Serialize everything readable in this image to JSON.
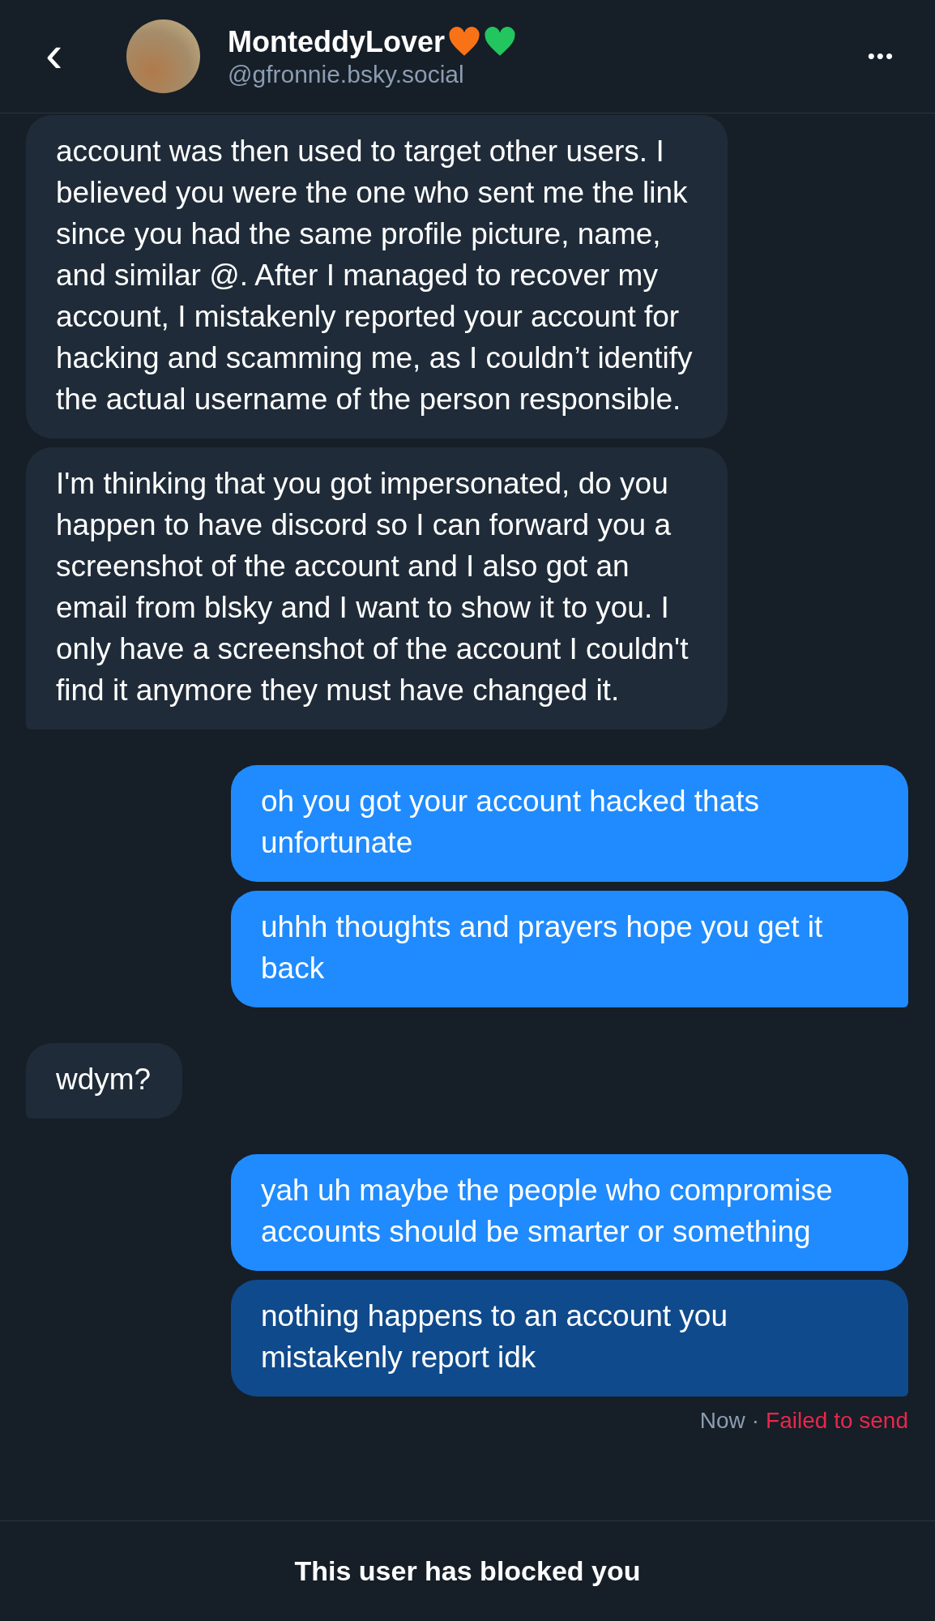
{
  "header": {
    "back": "‹",
    "name": "MonteddyLover",
    "name_hearts": [
      {
        "color": "#f97316"
      },
      {
        "color": "#22c55e"
      }
    ],
    "handle": "@gfronnie.bsky.social",
    "menu": "•••"
  },
  "messages": [
    {
      "kind": "incoming",
      "failed": false,
      "text": "account was then used to target other users. I believed you were the one who sent me the link since you had the same profile picture, name, and similar @. After I managed to recover my account, I mistakenly reported your account for hacking and scamming me, as I couldn’t identify the actual username of the person responsible."
    },
    {
      "kind": "incoming",
      "failed": false,
      "text": "I'm thinking that you got impersonated, do you happen to have discord so I can forward you a screenshot of the account and I also got an email from blsky and I want to show it to you. I only have a screenshot of the account I couldn't find it anymore they must have changed it."
    },
    {
      "kind": "outgoing",
      "failed": false,
      "text": "oh you got your account hacked thats unfortunate"
    },
    {
      "kind": "outgoing",
      "failed": false,
      "text": "uhhh thoughts and prayers hope you get it back"
    },
    {
      "kind": "incoming",
      "failed": false,
      "text": "wdym?"
    },
    {
      "kind": "outgoing",
      "failed": false,
      "text": "yah uh maybe the people who compromise accounts should be smarter or something"
    },
    {
      "kind": "outgoing",
      "failed": true,
      "text": "nothing happens to an account you mistakenly report idk"
    }
  ],
  "meta": {
    "time": "Now",
    "separator": "·",
    "status": "Failed to send"
  },
  "footer": {
    "notice": "This user has blocked you"
  }
}
